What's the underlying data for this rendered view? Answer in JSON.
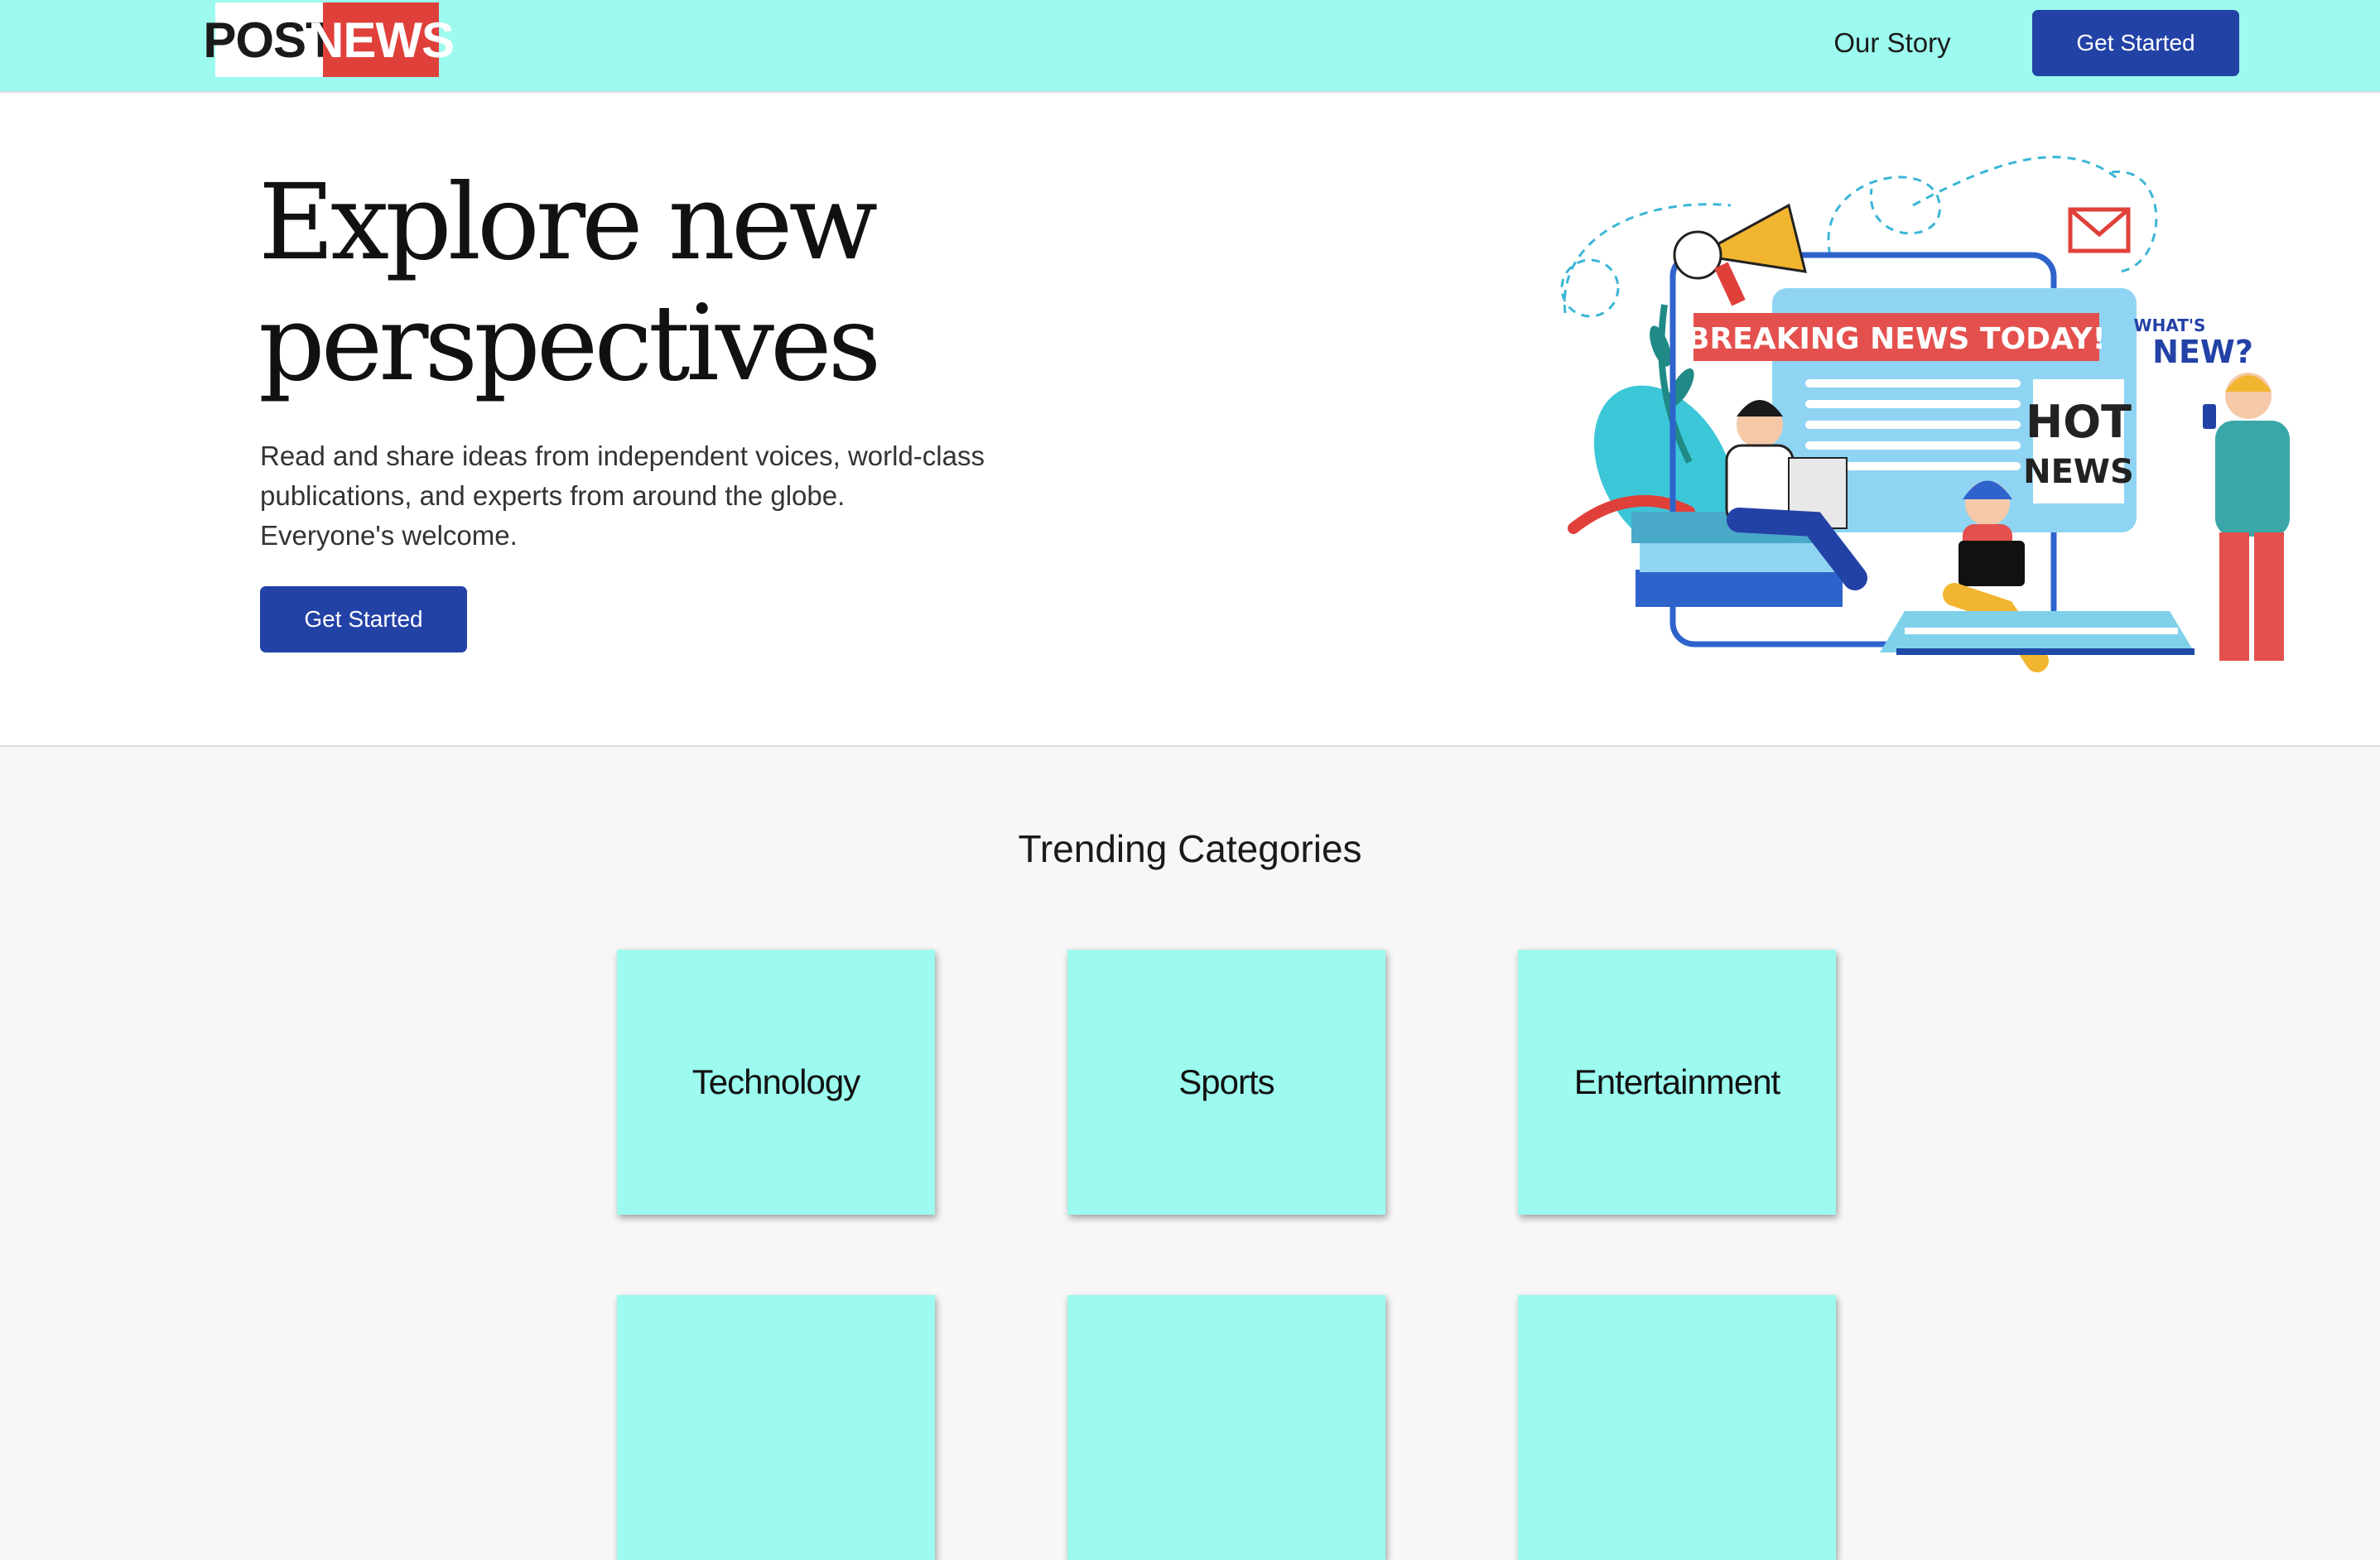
{
  "nav": {
    "logo_part1": "POST",
    "logo_part2": "NEWS",
    "our_story": "Our Story",
    "get_started": "Get Started"
  },
  "hero": {
    "title_line1": "Explore new",
    "title_line2": "perspectives",
    "subtitle_line1": "Read and share ideas from independent voices, world-class",
    "subtitle_line2": "publications, and experts from around the globe.",
    "subtitle_line3": "Everyone's welcome.",
    "cta": "Get Started"
  },
  "illustration": {
    "banner": "BREAKING NEWS TODAY!",
    "hot": "HOT",
    "news": "NEWS",
    "whats": "WHAT'S",
    "new": "NEW?"
  },
  "trending": {
    "title": "Trending Categories",
    "categories": [
      {
        "label": "Technology"
      },
      {
        "label": "Sports"
      },
      {
        "label": "Entertainment"
      }
    ]
  },
  "colors": {
    "accent": "#9cfaee",
    "button": "#2342a6",
    "logo_red": "#e0403a"
  }
}
